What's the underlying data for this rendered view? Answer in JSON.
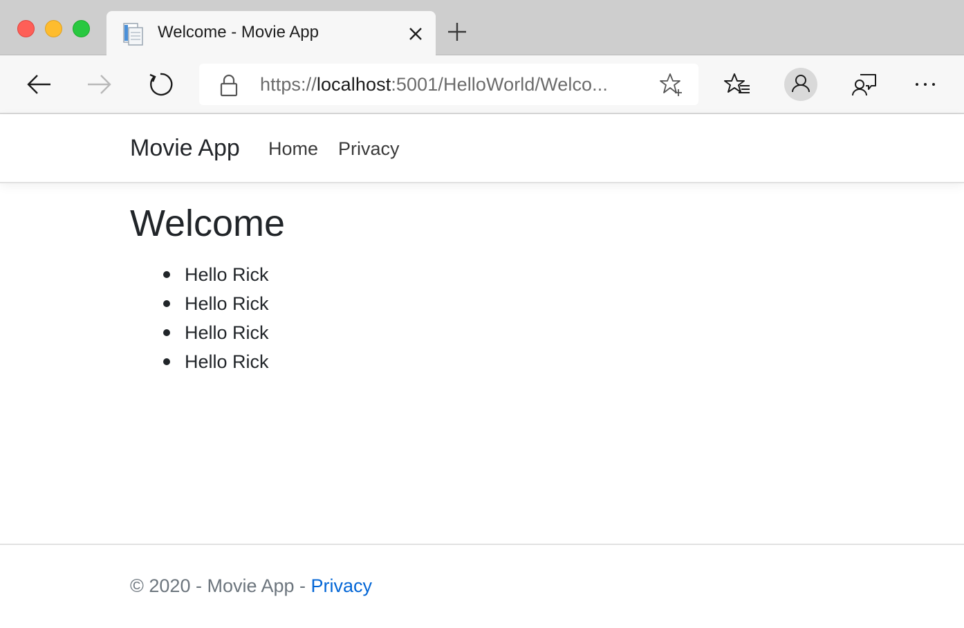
{
  "window": {
    "controls": [
      "close",
      "minimize",
      "maximize"
    ]
  },
  "tab": {
    "title": "Welcome - Movie App",
    "favicon": "page-icon"
  },
  "toolbar": {
    "back": "back-arrow-icon",
    "forward": "forward-arrow-icon",
    "reload": "reload-icon",
    "address": {
      "scheme": "https://",
      "host": "localhost",
      "rest": ":5001/HelloWorld/Welco..."
    },
    "favorites": "favorites-icon",
    "profile": "profile-icon",
    "feedback": "feedback-icon",
    "menu": "···"
  },
  "navbar": {
    "brand": "Movie App",
    "links": [
      "Home",
      "Privacy"
    ]
  },
  "main": {
    "heading": "Welcome",
    "greetings": [
      "Hello Rick",
      "Hello Rick",
      "Hello Rick",
      "Hello Rick"
    ]
  },
  "footer": {
    "prefix": "© 2020 - Movie App - ",
    "link": "Privacy"
  },
  "colors": {
    "link": "#0366d6",
    "text": "#212529",
    "muted": "#6c757d",
    "traffic_close": "#fe5f57",
    "traffic_minimize": "#febc2e",
    "traffic_maximize": "#28c840"
  }
}
